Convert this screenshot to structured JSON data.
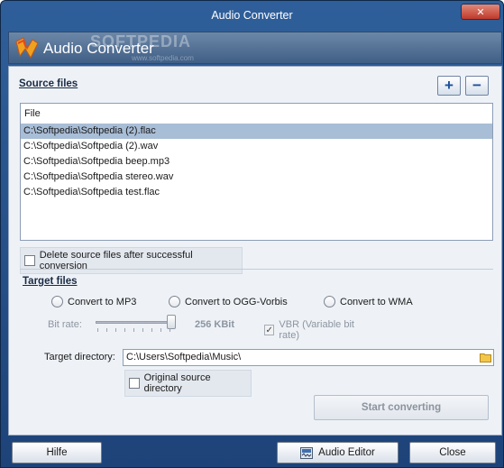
{
  "window": {
    "title": "Audio Converter"
  },
  "banner": {
    "title": "Audio Converter",
    "watermark": "SOFTPEDIA",
    "watermark_url": "www.softpedia.com"
  },
  "source": {
    "section_title": "Source files",
    "add_icon": "plus-icon",
    "remove_icon": "minus-icon",
    "list_header": "File",
    "files": [
      "C:\\Softpedia\\Softpedia (2).flac",
      "C:\\Softpedia\\Softpedia (2).wav",
      "C:\\Softpedia\\Softpedia beep.mp3",
      "C:\\Softpedia\\Softpedia stereo.wav",
      "C:\\Softpedia\\Softpedia test.flac"
    ],
    "selected_index": 0,
    "delete_label": "Delete source files after successful conversion"
  },
  "target": {
    "section_title": "Target files",
    "formats": [
      "Convert to MP3",
      "Convert to OGG-Vorbis",
      "Convert to WMA"
    ],
    "bitrate_label": "Bit rate:",
    "bitrate_value": "256 KBit",
    "vbr_label": "VBR (Variable bit rate)",
    "directory_label": "Target directory:",
    "directory_value": "C:\\Users\\Softpedia\\Music\\",
    "original_dir_label": "Original source directory",
    "start_label": "Start converting"
  },
  "footer": {
    "help_label": "Hilfe",
    "editor_label": "Audio Editor",
    "close_label": "Close"
  },
  "colors": {
    "titlebar": "#2f5f9a",
    "panel": "#eef2f7",
    "selection": "#a8bdd6"
  }
}
